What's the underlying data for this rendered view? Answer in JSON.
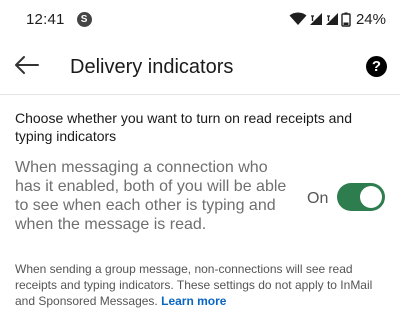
{
  "status_bar": {
    "time": "12:41",
    "app_icon_glyph": "S",
    "battery": "24%",
    "icons": [
      "wifi-icon",
      "signal-icon",
      "signal-icon",
      "battery-icon"
    ]
  },
  "header": {
    "back_icon": "arrow-left-icon",
    "title": "Delivery indicators",
    "help_icon": "help-icon",
    "help_glyph": "?"
  },
  "content": {
    "heading": "Choose whether you want to turn on read receipts and typing indicators",
    "setting": {
      "description": "When messaging a connection who has it enabled, both of you will be able to see when each other is typing and when the message is read.",
      "toggle_label": "On",
      "enabled": true
    },
    "footnote": "When sending a group message, non-connections will see read receipts and typing indicators. These settings do not apply to InMail and Sponsored Messages.",
    "learn_more": "Learn more"
  },
  "colors": {
    "accent": "#0a66c2",
    "toggle_on": "#2e7d4f"
  }
}
